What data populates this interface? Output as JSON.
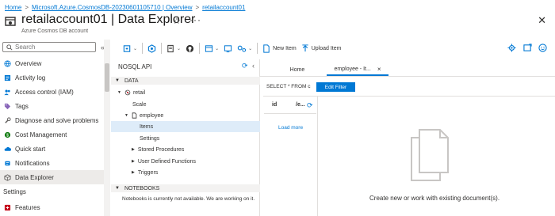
{
  "breadcrumb": {
    "items": [
      "Home",
      "Microsoft.Azure.CosmosDB-20230601105710 | Overview",
      "retailaccount01"
    ],
    "separator": ">"
  },
  "header": {
    "title": "retailaccount01 | Data Explorer",
    "subtitle": "Azure Cosmos DB account",
    "favorite_glyph": "☆",
    "more_glyph": "···",
    "close_glyph": "✕"
  },
  "sidebar": {
    "search_placeholder": "Search",
    "collapse_glyph": "«",
    "items": [
      {
        "label": "Overview",
        "icon": "globe-icon",
        "color": "#0078d4"
      },
      {
        "label": "Activity log",
        "icon": "activity-log-icon",
        "color": "#0078d4"
      },
      {
        "label": "Access control (IAM)",
        "icon": "iam-people-icon",
        "color": "#0078d4"
      },
      {
        "label": "Tags",
        "icon": "tag-icon",
        "color": "#8764b8"
      },
      {
        "label": "Diagnose and solve problems",
        "icon": "wrench-icon",
        "color": "#605e5c"
      },
      {
        "label": "Cost Management",
        "icon": "cost-icon",
        "color": "#107c10"
      },
      {
        "label": "Quick start",
        "icon": "cloud-icon",
        "color": "#0078d4"
      },
      {
        "label": "Notifications",
        "icon": "bell-icon",
        "color": "#0078d4"
      },
      {
        "label": "Data Explorer",
        "icon": "cube-icon",
        "color": "#605e5c"
      }
    ],
    "section_label": "Settings",
    "section_items": [
      {
        "label": "Features",
        "icon": "features-icon",
        "color": "#c50f1f"
      }
    ]
  },
  "toolbar": {
    "new_item_label": "New Item",
    "upload_item_label": "Upload Item",
    "caret_glyph": "⌄"
  },
  "tree": {
    "header": "NOSQL API",
    "refresh_glyph": "⟳",
    "collapse_glyph": "‹",
    "data_section": "DATA",
    "database": "retail",
    "scale": "Scale",
    "container": "employee",
    "children": [
      "Items",
      "Settings",
      "Stored Procedures",
      "User Defined Functions",
      "Triggers"
    ],
    "notebooks_section": "NOTEBOOKS",
    "notebooks_message": "Notebooks is currently not available. We are working on it."
  },
  "tabs": [
    {
      "label": "Home"
    },
    {
      "label": "employee - It...",
      "close_glyph": "×"
    }
  ],
  "query": {
    "text": "SELECT * FROM c",
    "edit_filter_label": "Edit Filter"
  },
  "documents": {
    "columns": [
      "id",
      "/e..."
    ],
    "refresh_glyph": "⟳",
    "load_more": "Load more"
  },
  "empty_state": {
    "message": "Create new or work with existing document(s)."
  },
  "colors": {
    "accent": "#0078d4",
    "selected_row": "#deecf9",
    "section_bar": "#f3f2f1"
  }
}
